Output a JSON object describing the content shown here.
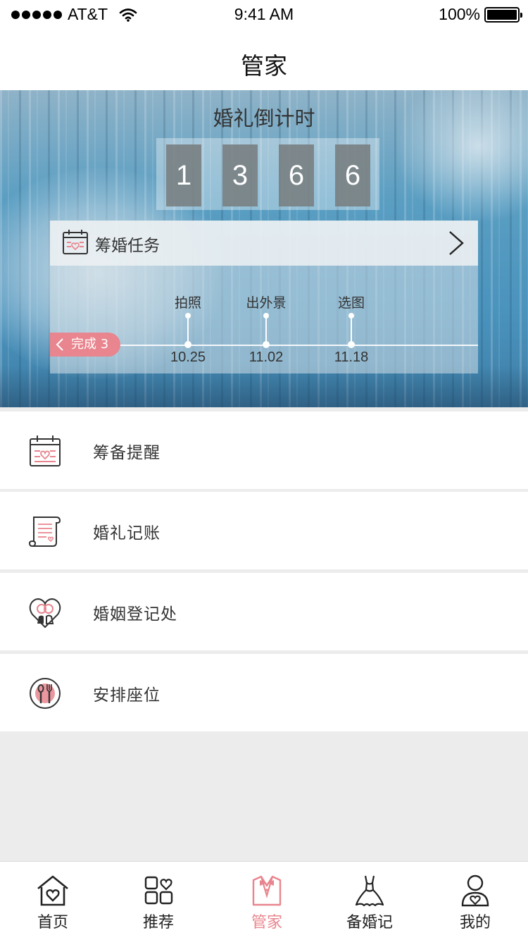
{
  "status_bar": {
    "carrier": "AT&T",
    "time": "9:41 AM",
    "battery": "100%"
  },
  "nav": {
    "title": "管家"
  },
  "countdown": {
    "title": "婚礼倒计时",
    "digits": [
      "1",
      "3",
      "6",
      "6"
    ]
  },
  "tasks": {
    "title": "筹婚任务",
    "done_badge": "完成 3",
    "milestones": [
      {
        "label": "拍照",
        "date": "10.25"
      },
      {
        "label": "出外景",
        "date": "11.02"
      },
      {
        "label": "选图",
        "date": "11.18"
      }
    ]
  },
  "menu": {
    "items": [
      {
        "label": "筹备提醒",
        "icon": "calendar-heart-icon"
      },
      {
        "label": "婚礼记账",
        "icon": "scroll-icon"
      },
      {
        "label": "婚姻登记处",
        "icon": "heart-rings-icon"
      },
      {
        "label": "安排座位",
        "icon": "plate-utensils-icon"
      }
    ]
  },
  "tab_bar": {
    "active_color": "#e8858e",
    "tabs": [
      {
        "label": "首页",
        "icon": "home-heart-icon",
        "active": false
      },
      {
        "label": "推荐",
        "icon": "grid-heart-icon",
        "active": false
      },
      {
        "label": "管家",
        "icon": "tuxedo-icon",
        "active": true
      },
      {
        "label": "备婚记",
        "icon": "wedding-dress-icon",
        "active": false
      },
      {
        "label": "我的",
        "icon": "user-heart-icon",
        "active": false
      }
    ]
  }
}
